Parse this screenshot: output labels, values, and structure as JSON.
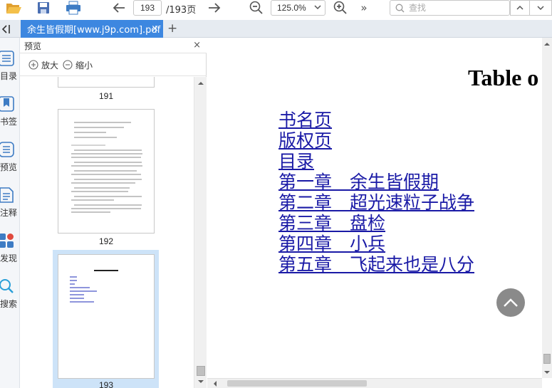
{
  "toolbar": {
    "current_page": "193",
    "page_total": "/193页",
    "zoom_value": "125.0%",
    "search_placeholder": "查找",
    "more_label": "»"
  },
  "tabs": [
    {
      "label": "余生皆假期[www.j9p.com].pdf",
      "close": "×"
    }
  ],
  "tab_add": "+",
  "rail": {
    "items": [
      {
        "label": "目录",
        "icon": "toc-icon"
      },
      {
        "label": "书签",
        "icon": "bookmark-icon"
      },
      {
        "label": "预览",
        "icon": "preview-icon"
      },
      {
        "label": "注释",
        "icon": "annotation-icon"
      },
      {
        "label": "发现",
        "icon": "apps-icon"
      },
      {
        "label": "搜索",
        "icon": "search-icon"
      }
    ]
  },
  "panel": {
    "title": "预览",
    "close": "×",
    "zoom_in_label": "放大",
    "zoom_out_label": "缩小",
    "thumbnails": [
      {
        "page": "191"
      },
      {
        "page": "192"
      },
      {
        "page": "193",
        "selected": true
      }
    ]
  },
  "document": {
    "title": "Table o",
    "toc": [
      "书名页",
      "版权页",
      "目录",
      "第一章　余生皆假期",
      "第二章　超光速粒子战争",
      "第三章　盘检",
      "第四章　小兵",
      "第五章　飞起来也是八分"
    ]
  },
  "colors": {
    "accent": "#3d87e0",
    "link": "#1a1aa6",
    "selection": "#cde3f8"
  }
}
